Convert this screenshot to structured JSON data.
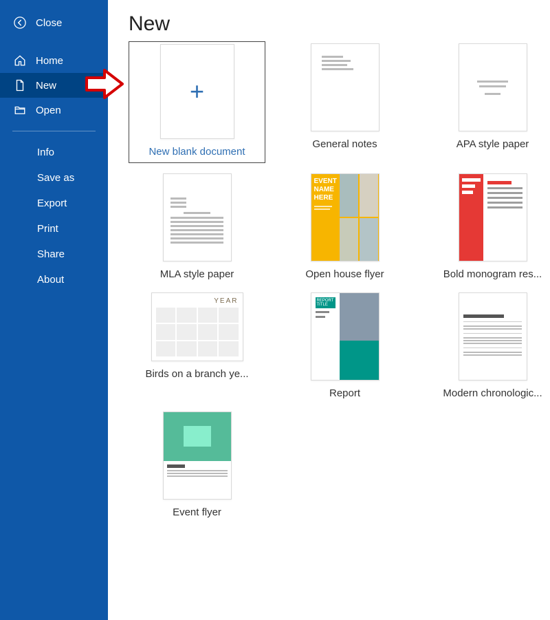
{
  "sidebar": {
    "close_label": "Close",
    "nav": [
      {
        "label": "Home",
        "icon": "home-icon",
        "selected": false
      },
      {
        "label": "New",
        "icon": "new-doc-icon",
        "selected": true
      },
      {
        "label": "Open",
        "icon": "open-folder-icon",
        "selected": false
      }
    ],
    "subnav": [
      {
        "label": "Info"
      },
      {
        "label": "Save as"
      },
      {
        "label": "Export"
      },
      {
        "label": "Print"
      },
      {
        "label": "Share"
      },
      {
        "label": "About"
      }
    ]
  },
  "main": {
    "title": "New",
    "templates": [
      {
        "label": "New blank document",
        "kind": "blank",
        "primary": true
      },
      {
        "label": "General notes",
        "kind": "notes"
      },
      {
        "label": "APA style paper",
        "kind": "apa"
      },
      {
        "label": "MLA style paper",
        "kind": "mla"
      },
      {
        "label": "Open house flyer",
        "kind": "flyer"
      },
      {
        "label": "Bold monogram res...",
        "kind": "resume"
      },
      {
        "label": "Birds on a branch ye...",
        "kind": "calendar"
      },
      {
        "label": "Report",
        "kind": "report"
      },
      {
        "label": "Modern chronologic...",
        "kind": "chrono"
      },
      {
        "label": "Event flyer",
        "kind": "event"
      }
    ]
  },
  "annotation": {
    "arrow_target": "sidebar.nav.1"
  },
  "colors": {
    "sidebar_bg": "#0f58a8",
    "sidebar_selected_bg": "#004383",
    "accent": "#2f6fb3",
    "arrow": "#d50000"
  }
}
